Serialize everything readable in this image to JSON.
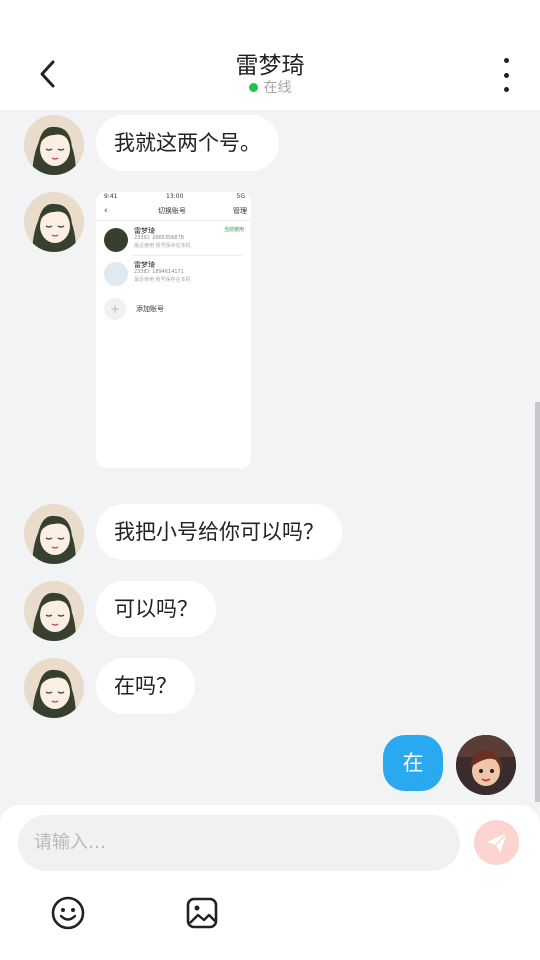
{
  "header": {
    "title": "雷梦琦",
    "status": "在线",
    "back_icon": "chevron-left-icon",
    "more_icon": "more-vertical-icon"
  },
  "messages": [
    {
      "side": "left",
      "type": "text",
      "text": "我就这两个号。"
    },
    {
      "side": "left",
      "type": "image",
      "screenshot": {
        "status_left": "9:41",
        "status_time": "13:00",
        "status_right": "5G",
        "title": "切换账号",
        "manage": "管理",
        "accounts": [
          {
            "name": "雷梦琦",
            "id": "233ID: 2665356878",
            "note": "最近使用 账号保存在本机",
            "tag": "当前使用"
          },
          {
            "name": "雷梦琦",
            "id": "233ID: 1894614171",
            "note": "最近使用 账号保存在本机",
            "tag": ""
          }
        ],
        "add_label": "添加账号"
      }
    },
    {
      "side": "left",
      "type": "text",
      "text": "我把小号给你可以吗？"
    },
    {
      "side": "left",
      "type": "text",
      "text": "可以吗？"
    },
    {
      "side": "left",
      "type": "text",
      "text": "在吗？"
    },
    {
      "side": "right",
      "type": "text",
      "text": "在"
    }
  ],
  "input": {
    "placeholder": "请输入…",
    "send_icon": "send-icon",
    "emoji_icon": "emoji-icon",
    "image_icon": "image-icon"
  },
  "colors": {
    "online_dot": "#22c14b",
    "my_bubble": "#28a9f0",
    "send_disabled": "#fbd3cf",
    "background": "#f2f3f5"
  }
}
